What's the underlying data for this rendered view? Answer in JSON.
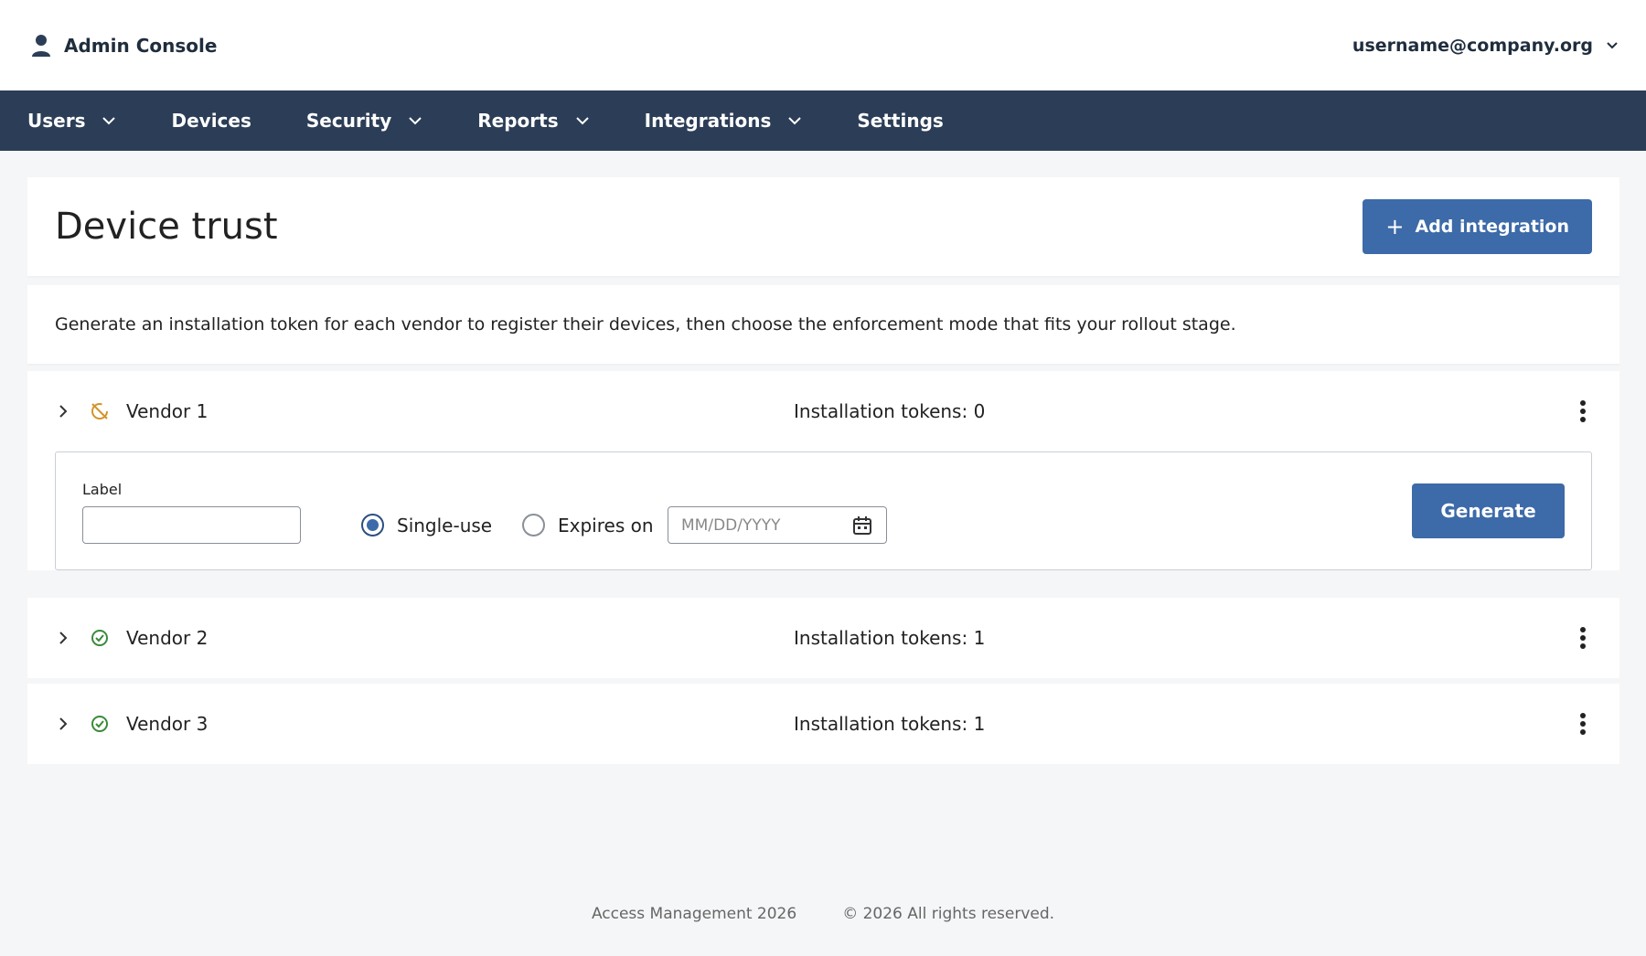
{
  "header": {
    "app_title": "Admin Console",
    "user_email": "username@company.org"
  },
  "nav": {
    "items": [
      {
        "label": "Users",
        "has_dropdown": true
      },
      {
        "label": "Devices",
        "has_dropdown": false
      },
      {
        "label": "Security",
        "has_dropdown": true
      },
      {
        "label": "Reports",
        "has_dropdown": true
      },
      {
        "label": "Integrations",
        "has_dropdown": true
      },
      {
        "label": "Settings",
        "has_dropdown": false
      }
    ]
  },
  "page": {
    "title": "Device trust",
    "add_button_label": "Add integration",
    "description": "Generate an installation token for each vendor to register their devices, then choose the enforcement mode that fits your rollout stage."
  },
  "vendors": [
    {
      "name": "Vendor 1",
      "tokens": "Installation tokens: 0",
      "status": "inactive",
      "expanded": true
    },
    {
      "name": "Vendor 2",
      "tokens": "Installation tokens: 1",
      "status": "active",
      "expanded": false
    },
    {
      "name": "Vendor 3",
      "tokens": "Installation tokens: 1",
      "status": "active",
      "expanded": false
    }
  ],
  "token_form": {
    "label_field_label": "Label",
    "label_value": "",
    "single_use_label": "Single-use",
    "expires_on_label": "Expires on",
    "selected_option": "Single-use",
    "date_placeholder": "MM/DD/YYYY",
    "generate_label": "Generate"
  },
  "footer": {
    "product": "Access Management 2026",
    "copyright": "© 2026 All rights reserved."
  },
  "colors": {
    "nav_bg": "#2c3e57",
    "primary": "#3d6aa8",
    "active_status": "#3a8a3a",
    "inactive_status": "#d4942a"
  }
}
